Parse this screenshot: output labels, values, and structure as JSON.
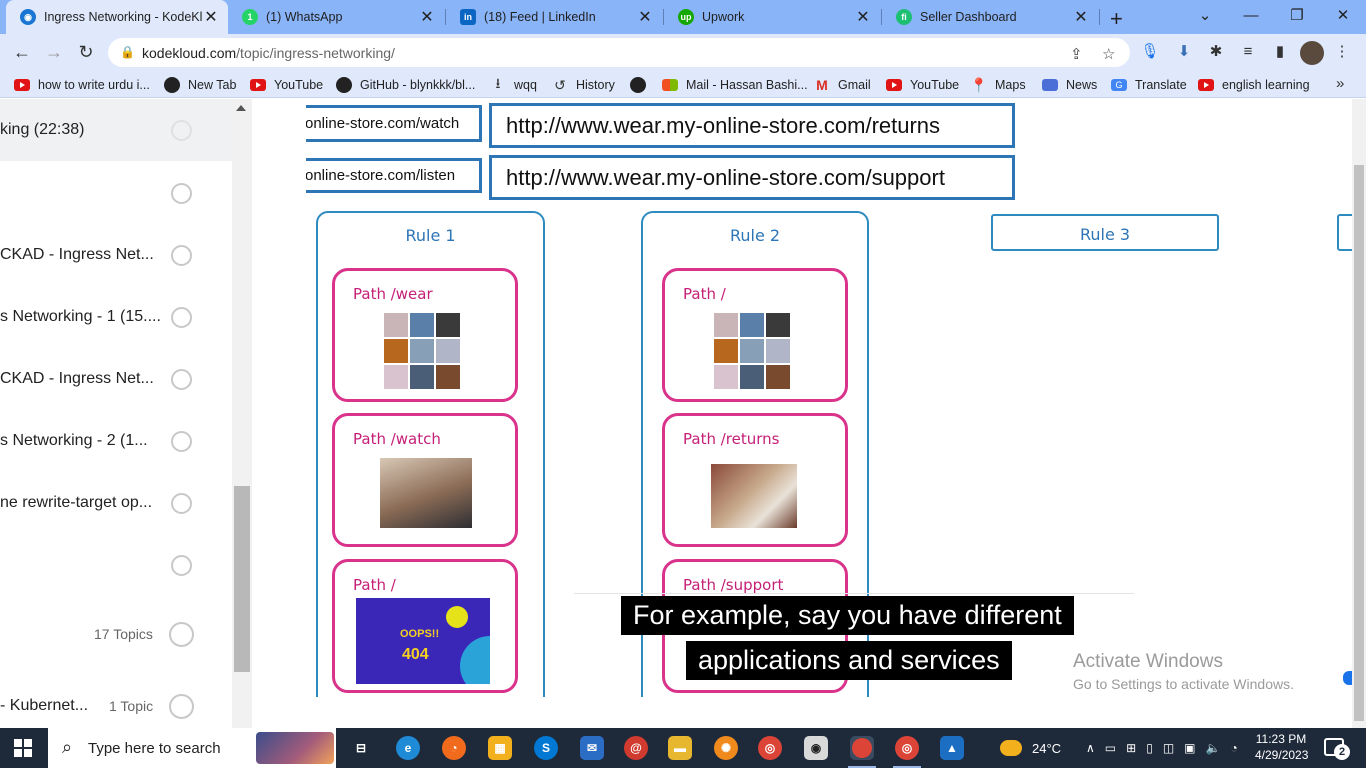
{
  "tabs": [
    {
      "title": "Ingress Networking - KodeKl",
      "icon": "kodekloud-icon",
      "active": true
    },
    {
      "title": "(1) WhatsApp",
      "icon": "whatsapp-icon"
    },
    {
      "title": "(18) Feed | LinkedIn",
      "icon": "linkedin-icon"
    },
    {
      "title": "Upwork",
      "icon": "upwork-icon"
    },
    {
      "title": "Seller Dashboard",
      "icon": "fiverr-icon"
    }
  ],
  "address": {
    "host": "kodekloud.com",
    "path": "/topic/ingress-networking/"
  },
  "bookmarks": [
    {
      "label": "how to write urdu i...",
      "icon": "youtube-icon"
    },
    {
      "label": "New Tab",
      "icon": "globe-icon"
    },
    {
      "label": "YouTube",
      "icon": "youtube-icon"
    },
    {
      "label": "GitHub - blynkkk/bl...",
      "icon": "github-icon"
    },
    {
      "label": "wqq",
      "icon": "download-icon"
    },
    {
      "label": "History",
      "icon": "history-icon"
    },
    {
      "label": "",
      "icon": "globe-icon"
    },
    {
      "label": "Mail - Hassan Bashi...",
      "icon": "microsoft-icon"
    },
    {
      "label": "Gmail",
      "icon": "gmail-icon"
    },
    {
      "label": "YouTube",
      "icon": "youtube-icon"
    },
    {
      "label": "Maps",
      "icon": "maps-icon"
    },
    {
      "label": "News",
      "icon": "news-icon"
    },
    {
      "label": "Translate",
      "icon": "translate-icon"
    },
    {
      "label": "english learning",
      "icon": "youtube-icon"
    }
  ],
  "sidebar": {
    "items": [
      {
        "label": "king (22:38)",
        "count": ""
      },
      {
        "label": "",
        "count": ""
      },
      {
        "label": "CKAD - Ingress Net...",
        "count": ""
      },
      {
        "label": "s Networking - 1 (15....",
        "count": ""
      },
      {
        "label": "CKAD - Ingress Net...",
        "count": ""
      },
      {
        "label": "s Networking - 2 (1...",
        "count": ""
      },
      {
        "label": "ne rewrite-target op...",
        "count": ""
      },
      {
        "label": "",
        "count": ""
      },
      {
        "label": "",
        "count": "17 Topics"
      },
      {
        "label": " - Kubernet...",
        "count": "1 Topic"
      }
    ]
  },
  "slide": {
    "urls": [
      {
        "short": "online-store.com/watch",
        "long": "http://www.wear.my-online-store.com/returns"
      },
      {
        "short": "online-store.com/listen",
        "long": "http://www.wear.my-online-store.com/support"
      }
    ],
    "rules": [
      {
        "title": "Rule 1",
        "paths": [
          "Path /wear",
          "Path /watch",
          "Path /"
        ]
      },
      {
        "title": "Rule 2",
        "paths": [
          "Path /",
          "Path /returns",
          "Path /support"
        ]
      },
      {
        "title": "Rule 3",
        "paths": []
      }
    ],
    "oops_text": "OOPS!!",
    "error_code": "404",
    "subtitle": [
      "For example, say you have different",
      "applications and services"
    ]
  },
  "watermark": {
    "line1": "Activate Windows",
    "line2": "Go to Settings to activate Windows."
  },
  "taskbar": {
    "search_placeholder": "Type here to search",
    "weather": "24°C",
    "time": "11:23 PM",
    "date": "4/29/2023",
    "notifications": "2"
  },
  "colors": {
    "tab_strip": "#8ab4f8",
    "toolbar": "#dfe9fb",
    "rule_blue": "#2e75b6",
    "path_pink": "#d9338b",
    "taskbar": "#1e2a3a"
  }
}
